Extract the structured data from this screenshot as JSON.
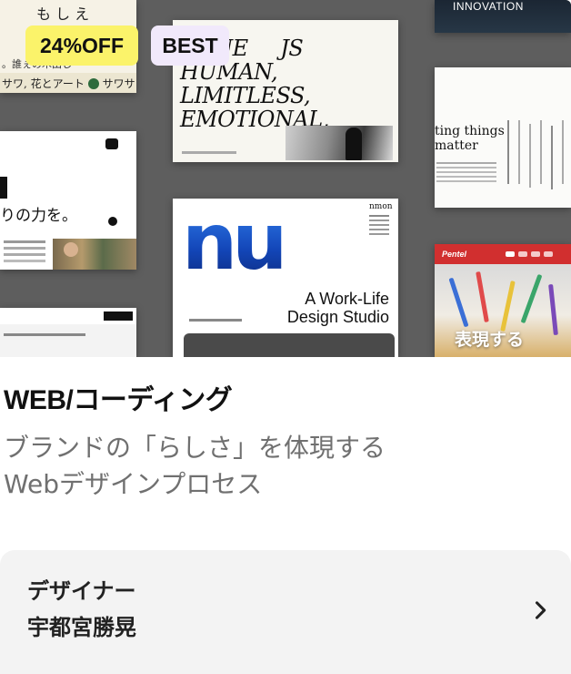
{
  "thumbnail": {
    "left_top_kana": "も し え\nて わ",
    "left_top_row1": "。誰ぇの木田し",
    "left_top_row2": "サワ, 花とアート",
    "left_top_row2_end": "サワサ",
    "left_mid_text": "りの力を。",
    "center_top_title": "OGUE     JS\nHUMAN,\nLIMITLESS,\nEMOTIONAL,",
    "center_bot_logo": "nu",
    "center_bot_brand": "nmon",
    "center_bot_tagline": "A Work-Life\nDesign Studio",
    "right_top_word": "INNOVATION",
    "right_mid_text": "ting things\nmatter",
    "right_bot_logo": "Pentel",
    "right_bot_text": "表現する"
  },
  "badges": {
    "discount": "24%OFF",
    "best": "BEST"
  },
  "course": {
    "title": "WEB/コーディング",
    "description": "ブランドの「らしさ」を体現する\nWebデザインプロセス"
  },
  "author": {
    "role": "デザイナー",
    "name": "宇都宮勝晃",
    "chevron_icon": "chevron-right-icon"
  },
  "colors": {
    "discount_badge": "#fbf36a",
    "best_badge": "#f1e9fb",
    "thumbnail_bg": "#5e5e5e",
    "description_text": "#707070",
    "author_bg": "#f3f3f3",
    "nu_blue": "#1f63d6",
    "pentel_red": "#d12f2f"
  }
}
